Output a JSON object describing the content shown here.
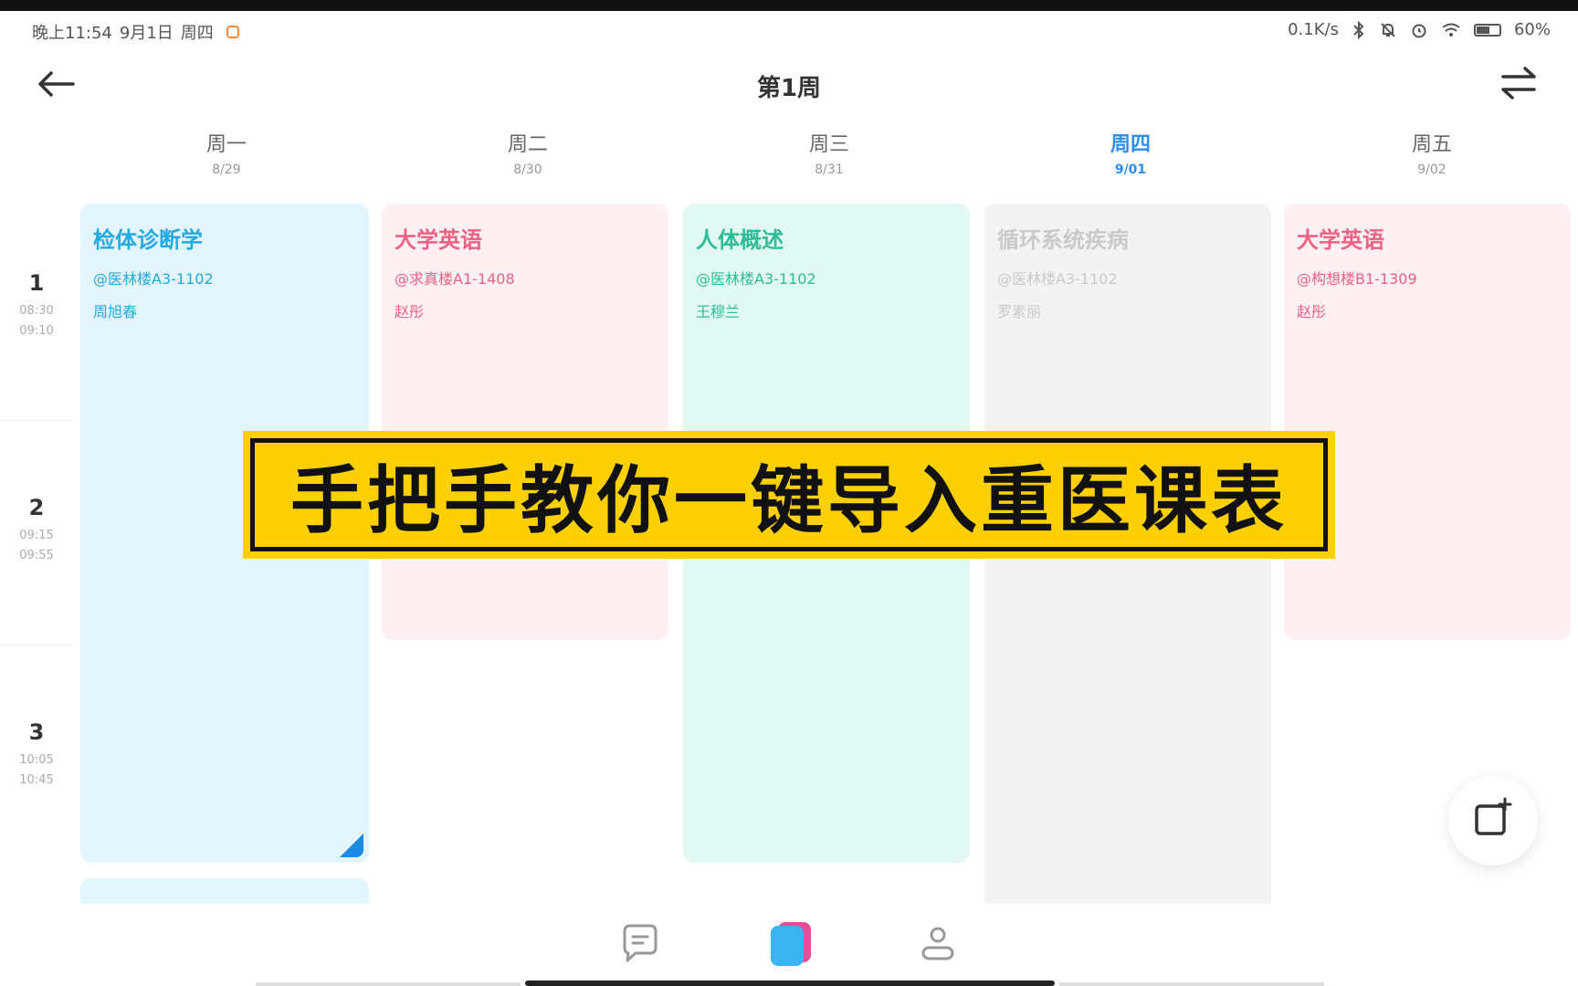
{
  "status_bar": {
    "time": "晚上11:54",
    "date": "9月1日",
    "weekday": "周四",
    "net_speed": "0.1K/s",
    "battery": "60%"
  },
  "header": {
    "title": "第1周"
  },
  "days": [
    {
      "name": "周一",
      "date": "8/29"
    },
    {
      "name": "周二",
      "date": "8/30"
    },
    {
      "name": "周三",
      "date": "8/31"
    },
    {
      "name": "周四",
      "date": "9/01"
    },
    {
      "name": "周五",
      "date": "9/02"
    }
  ],
  "periods": [
    {
      "num": "1",
      "start": "08:30",
      "end": "09:10"
    },
    {
      "num": "2",
      "start": "09:15",
      "end": "09:55"
    },
    {
      "num": "3",
      "start": "10:05",
      "end": "10:45"
    }
  ],
  "courses": [
    {
      "title": "检体诊断学",
      "room": "@医林楼A3-1102",
      "teacher": "周旭春"
    },
    {
      "title": "大学英语",
      "room": "@求真楼A1-1408",
      "teacher": "赵彤"
    },
    {
      "title": "人体概述",
      "room": "@医林楼A3-1102",
      "teacher": "王穆兰"
    },
    {
      "title": "循环系统疾病",
      "room": "@医林楼A3-1102",
      "teacher": "罗素丽"
    },
    {
      "title": "大学英语",
      "room": "@构想楼B1-1309",
      "teacher": "赵彤"
    },
    {
      "title": "",
      "room": "",
      "teacher": ""
    }
  ],
  "banner": {
    "text": "手把手教你一键导入重医课表"
  },
  "colors": {
    "accent": "#2b8ef0",
    "banner_bg": "#ffd000"
  }
}
